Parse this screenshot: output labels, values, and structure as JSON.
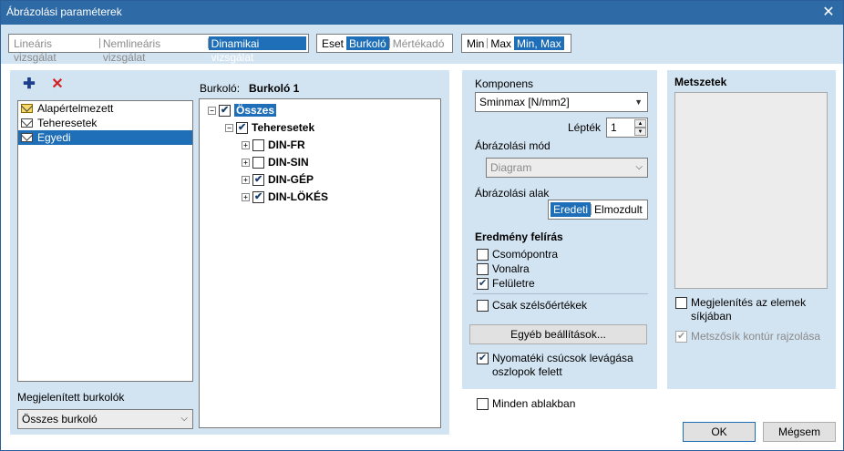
{
  "window": {
    "title": "Ábrázolási paraméterek",
    "close_glyph": "✕"
  },
  "toolbar": {
    "analysis": [
      {
        "label": "Lineáris vizsgálat",
        "state": "dim"
      },
      {
        "label": "Nemlineáris vizsgálat",
        "state": "dim"
      },
      {
        "label": "Dinamikai vizsgálat",
        "state": "selected"
      }
    ],
    "mode": [
      {
        "label": "Eset",
        "state": "normal"
      },
      {
        "label": "Burkoló",
        "state": "selected"
      },
      {
        "label": "Mértékadó",
        "state": "dim"
      }
    ],
    "minmax": [
      {
        "label": "Min",
        "state": "normal"
      },
      {
        "label": "Max",
        "state": "normal"
      },
      {
        "label": "Min, Max",
        "state": "selected"
      }
    ]
  },
  "left": {
    "add_glyph": "✚",
    "delete_glyph": "✕",
    "list": [
      {
        "label": "Alapértelmezett",
        "icon": "envelope-yellow-icon",
        "selected": false
      },
      {
        "label": "Teheresetek",
        "icon": "envelope-icon",
        "selected": false
      },
      {
        "label": "Egyedi",
        "icon": "envelope-icon",
        "selected": true
      }
    ],
    "displayed_label": "Megjelenített burkolók",
    "displayed_value": "Összes burkoló",
    "envelope_label": "Burkoló:",
    "envelope_name": "Burkoló 1",
    "tree": {
      "root": "Összes",
      "group": "Teheresetek",
      "items": [
        {
          "label": "DIN-FR",
          "checked": false
        },
        {
          "label": "DIN-SIN",
          "checked": false
        },
        {
          "label": "DIN-GÉP",
          "checked": true
        },
        {
          "label": "DIN-LÖKÉS",
          "checked": true
        }
      ]
    }
  },
  "middle": {
    "component_label": "Komponens",
    "component_value": "Sminmax [N/mm2]",
    "scale_label": "Lépték",
    "scale_value": "1",
    "display_mode_label": "Ábrázolási mód",
    "display_mode_value": "Diagram",
    "shape_label": "Ábrázolási alak",
    "shape_options": [
      {
        "label": "Eredeti",
        "selected": true
      },
      {
        "label": "Elmozdult",
        "selected": false
      }
    ],
    "result_heading": "Eredmény felírás",
    "result_options": [
      {
        "label": "Csomópontra",
        "checked": false
      },
      {
        "label": "Vonalra",
        "checked": false
      },
      {
        "label": "Felületre",
        "checked": true
      }
    ],
    "extremes_only": {
      "label": "Csak szélsőértékek",
      "checked": false
    },
    "other_settings": "Egyéb beállítások...",
    "moment_cut": {
      "label": "Nyomatéki csúcsok levágása oszlopok felett",
      "checked": true
    },
    "all_windows": {
      "label": "Minden ablakban",
      "checked": false
    }
  },
  "right": {
    "heading": "Metszetek",
    "in_plane": {
      "label": "Megjelenítés az elemek síkjában",
      "checked": false
    },
    "contour": {
      "label": "Metszősík kontúr rajzolása",
      "checked": true,
      "disabled": true
    }
  },
  "footer": {
    "ok": "OK",
    "cancel": "Mégsem"
  }
}
